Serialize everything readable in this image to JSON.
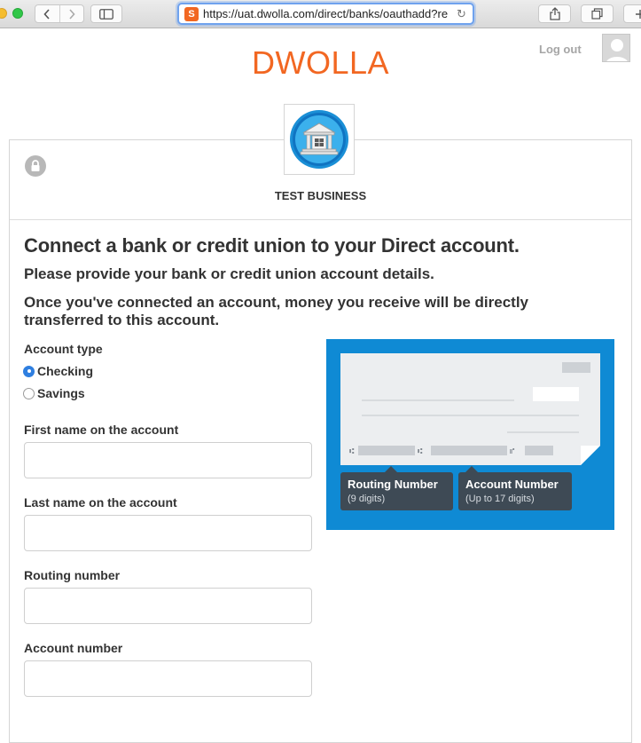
{
  "browser": {
    "url": "https://uat.dwolla.com/direct/banks/oauthadd?re",
    "favicon_letter": "S"
  },
  "header": {
    "logo": "DWOLLA",
    "logout_label": "Log out"
  },
  "business": {
    "name": "TEST BUSINESS"
  },
  "form": {
    "title": "Connect a bank or credit union to your Direct account.",
    "subtitle": "Please provide your bank or credit union account details.",
    "note": "Once you've connected an account, money you receive will be directly transferred to this account.",
    "account_type_label": "Account type",
    "account_types": [
      {
        "label": "Checking",
        "selected": true
      },
      {
        "label": "Savings",
        "selected": false
      }
    ],
    "first_name_label": "First name on the account",
    "first_name_value": "",
    "last_name_label": "Last name on the account",
    "last_name_value": "",
    "routing_label": "Routing number",
    "routing_value": "",
    "account_label": "Account number",
    "account_value": ""
  },
  "check_illustration": {
    "routing_title": "Routing Number",
    "routing_hint": "(9 digits)",
    "account_title": "Account Number",
    "account_hint": "(Up to 17 digits)"
  },
  "colors": {
    "brand": "#f26722",
    "panel_blue": "#0f8ad4",
    "tooltip": "#3e4a55",
    "radio_selected": "#2f7fe0"
  }
}
